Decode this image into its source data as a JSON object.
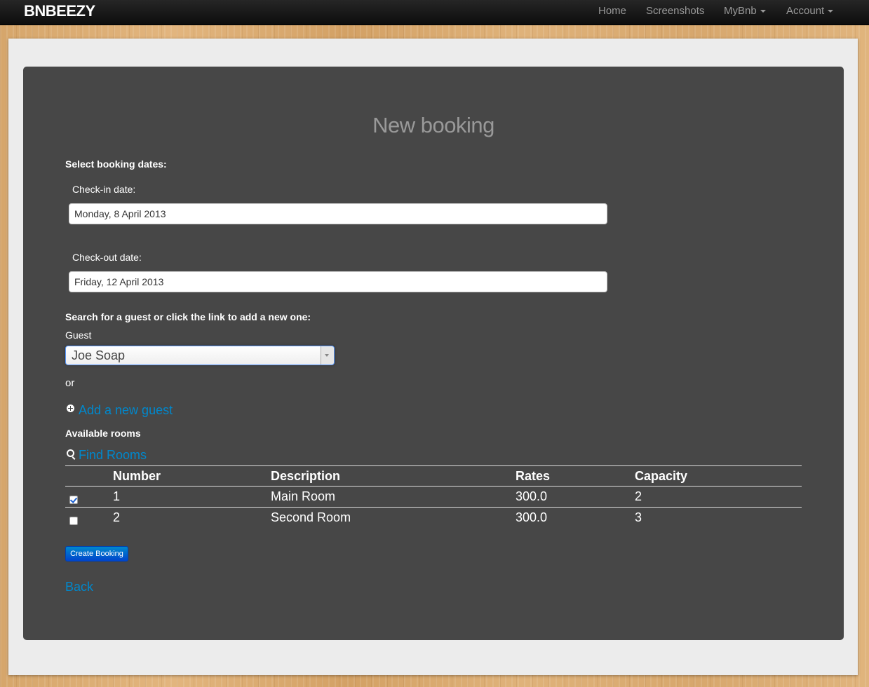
{
  "navbar": {
    "brand": "BNBEEZY",
    "items": [
      {
        "label": "Home"
      },
      {
        "label": "Screenshots"
      },
      {
        "label": "MyBnb"
      },
      {
        "label": "Account"
      }
    ]
  },
  "page": {
    "title": "New booking",
    "dates_heading": "Select booking dates:",
    "checkin_label": "Check-in date:",
    "checkin_value": "Monday, 8 April 2013",
    "checkout_label": "Check-out date:",
    "checkout_value": "Friday, 12 April 2013",
    "guest_heading": "Search for a guest or click the link to add a new one:",
    "guest_label": "Guest",
    "guest_selected": "Joe Soap",
    "or_text": "or",
    "add_guest_link": "Add a new guest",
    "rooms_heading": "Available rooms",
    "find_rooms_link": "Find Rooms",
    "create_button": "Create Booking",
    "back_link": "Back"
  },
  "rooms_table": {
    "headers": [
      "Number",
      "Description",
      "Rates",
      "Capacity"
    ],
    "rows": [
      {
        "checked": true,
        "number": "1",
        "description": "Main Room",
        "rate": "300.0",
        "capacity": "2"
      },
      {
        "checked": false,
        "number": "2",
        "description": "Second Room",
        "rate": "300.0",
        "capacity": "3"
      }
    ]
  },
  "colors": {
    "link": "#0088cc",
    "panel": "#474747",
    "primary_button": "#0055cc"
  }
}
